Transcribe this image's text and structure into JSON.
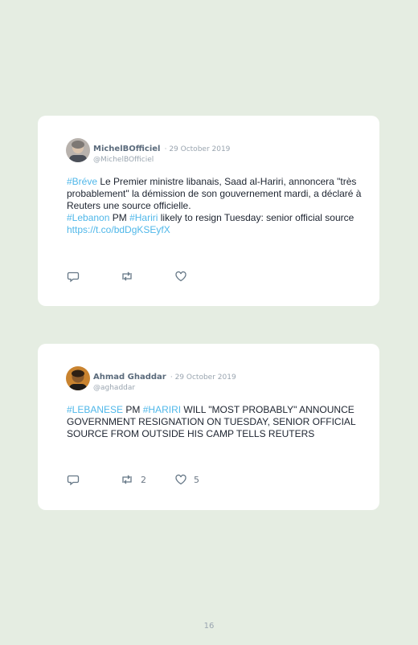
{
  "tweets": [
    {
      "name": "MichelBOfficiel",
      "date": "29 October 2019",
      "handle": "@MichelBOfficiel",
      "segments_line1": [
        {
          "t": "#Bréve",
          "tag": true
        },
        {
          "t": " Le Premier ministre libanais, Saad al-Hariri, annoncera \"très probablement\" la démission de son gouvernement mardi, a déclaré à Reuters une source officielle.",
          "tag": false
        }
      ],
      "segments_line2": [
        {
          "t": "#Lebanon",
          "tag": true
        },
        {
          "t": " PM ",
          "tag": false
        },
        {
          "t": "#Hariri",
          "tag": true
        },
        {
          "t": " likely to resign Tuesday: senior official source ",
          "tag": false
        },
        {
          "t": "https://t.co/bdDgKSEyfX",
          "tag": true
        }
      ],
      "retweets": "",
      "likes": ""
    },
    {
      "name": "Ahmad Ghaddar",
      "date": "29 October 2019",
      "handle": "@aghaddar",
      "segments_line1": [
        {
          "t": "#LEBANESE",
          "tag": true
        },
        {
          "t": " PM ",
          "tag": false
        },
        {
          "t": "#HARIRI",
          "tag": true
        },
        {
          "t": " WILL \"MOST PROBABLY\" ANNOUNCE GOVERNMENT RESIGNATION ON TUESDAY, SENIOR OFFICIAL SOURCE FROM OUTSIDE HIS CAMP TELLS REUTERS",
          "tag": false
        }
      ],
      "segments_line2": [],
      "retweets": "2",
      "likes": "5"
    }
  ],
  "icons": {
    "reply": "reply-icon",
    "retweet": "retweet-icon",
    "like": "heart-icon"
  },
  "colors": {
    "background": "#e5ede2",
    "hashtag": "#4fb7e9",
    "name": "#5b6b7c"
  },
  "page_number": "16"
}
